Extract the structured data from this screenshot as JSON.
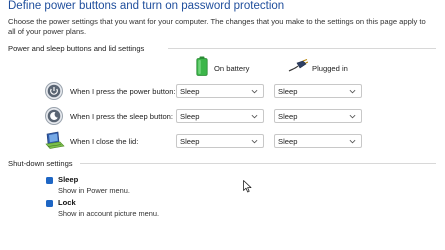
{
  "header": {
    "title": "Define power buttons and turn on password protection",
    "description": "Choose the power settings that you want for your computer. The changes that you make to the settings on this page apply to all of your power plans."
  },
  "power_section": {
    "title": "Power and sleep buttons and lid settings",
    "columns": {
      "on_battery": {
        "label": "On battery",
        "icon": "battery-icon"
      },
      "plugged_in": {
        "label": "Plugged in",
        "icon": "plug-icon"
      }
    },
    "rows": [
      {
        "label": "When I press the power button:",
        "icon": "power-button-icon",
        "on_battery": "Sleep",
        "plugged_in": "Sleep"
      },
      {
        "label": "When I press the sleep button:",
        "icon": "sleep-button-icon",
        "on_battery": "Sleep",
        "plugged_in": "Sleep"
      },
      {
        "label": "When I close the lid:",
        "icon": "laptop-lid-icon",
        "on_battery": "Sleep",
        "plugged_in": "Sleep"
      }
    ]
  },
  "shutdown_section": {
    "title": "Shut-down settings",
    "options": [
      {
        "title": "Sleep",
        "description": "Show in Power menu.",
        "checked": true
      },
      {
        "title": "Lock",
        "description": "Show in account picture menu.",
        "checked": true
      }
    ]
  },
  "colors": {
    "title": "#1f4e9c",
    "checkbox": "#1e66c4",
    "battery": "#3cb64a"
  }
}
